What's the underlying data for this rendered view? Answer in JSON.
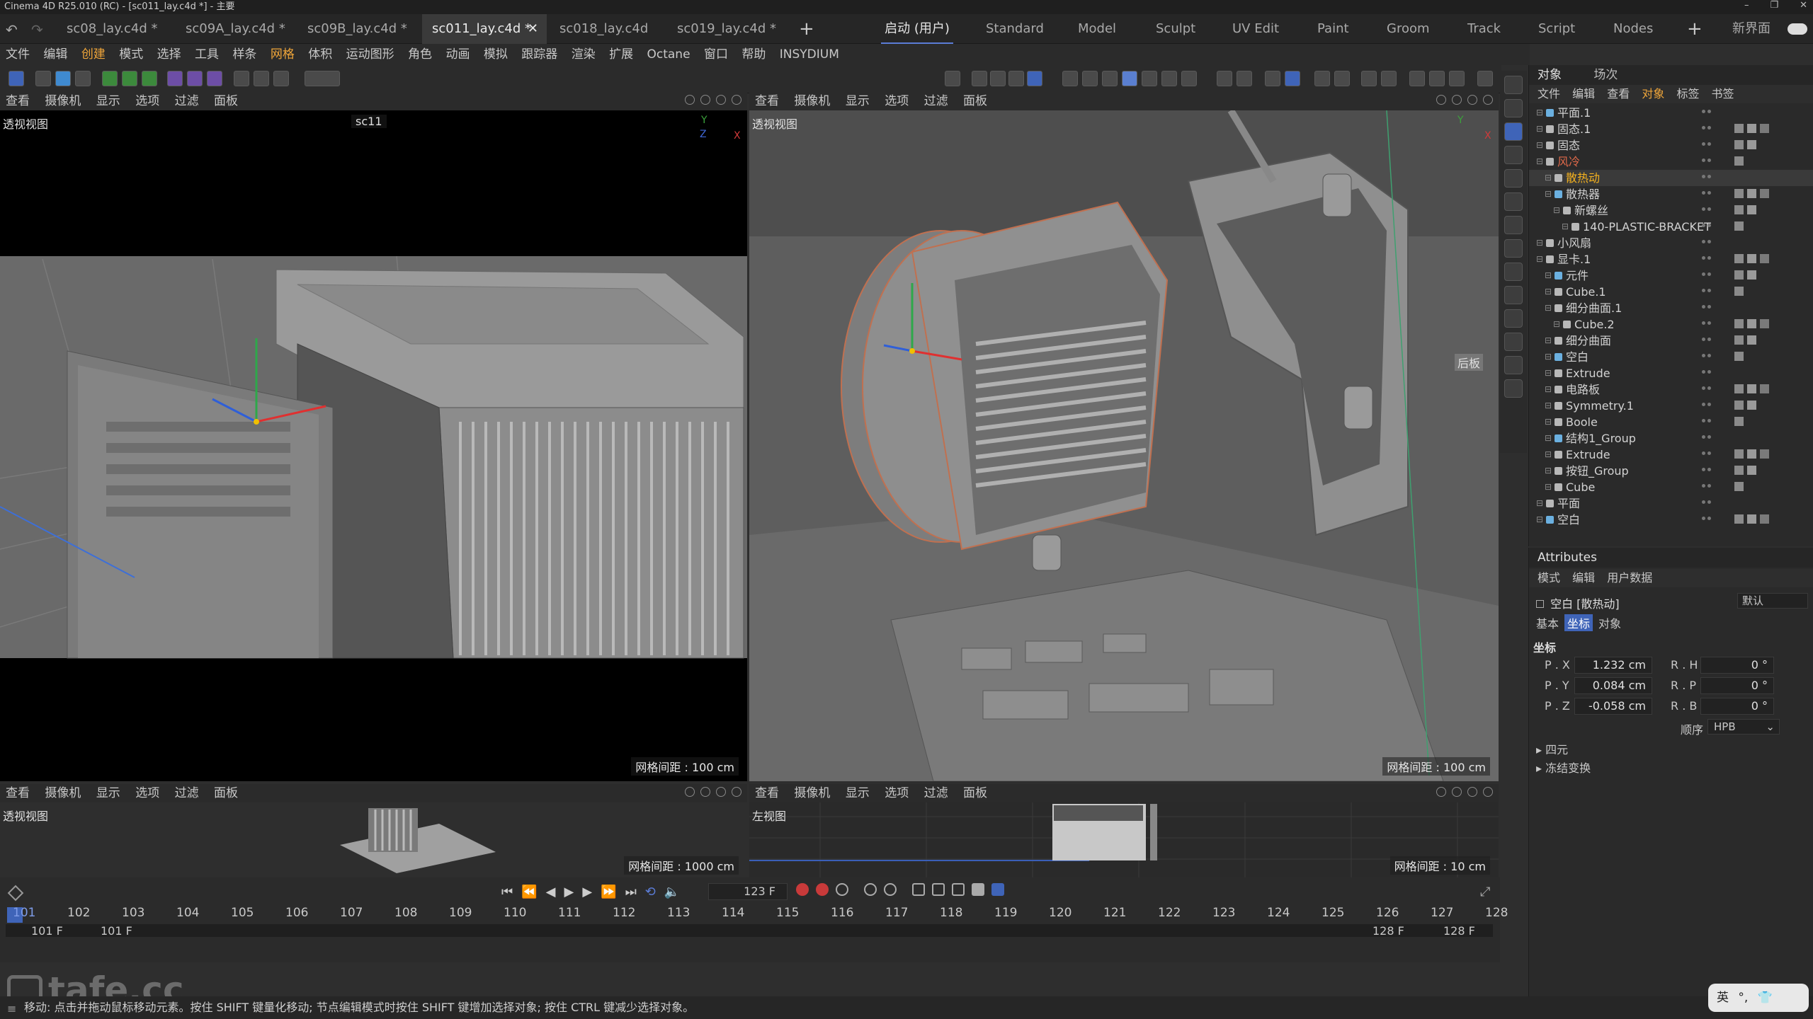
{
  "titlebar": {
    "text": "Cinema 4D R25.010 (RC) - [sc011_lay.c4d *] - 主要"
  },
  "file_tabs": [
    "sc08_lay.c4d *",
    "sc09A_lay.c4d *",
    "sc09B_lay.c4d *",
    "sc011_lay.c4d *",
    "sc018_lay.c4d",
    "sc019_lay.c4d *"
  ],
  "layout_tabs": [
    "启动 (用户)",
    "Standard",
    "Model",
    "Sculpt",
    "UV Edit",
    "Paint",
    "Groom",
    "Track",
    "Script",
    "Nodes",
    "新界面"
  ],
  "menu": [
    "文件",
    "编辑",
    "创建",
    "模式",
    "选择",
    "工具",
    "样条",
    "网格",
    "体积",
    "运动图形",
    "角色",
    "动画",
    "模拟",
    "跟踪器",
    "渲染",
    "扩展",
    "Octane",
    "窗口",
    "帮助",
    "INSYDIUM"
  ],
  "viewport_menu": [
    "查看",
    "摄像机",
    "显示",
    "选项",
    "过滤",
    "面板"
  ],
  "viewports": {
    "tl": {
      "name": "透视视图",
      "camera": "sc11",
      "grid": "网格间距 : 100 cm"
    },
    "tr": {
      "name": "透视视图",
      "tag": "后板",
      "grid": "网格间距 : 100 cm"
    },
    "bl": {
      "name": "透视视图",
      "grid": "网格间距 : 1000 cm"
    },
    "br": {
      "name": "左视图",
      "grid": "网格间距 : 10 cm"
    }
  },
  "object_manager": {
    "tabs": [
      "对象",
      "场次"
    ],
    "menu": [
      "文件",
      "编辑",
      "查看",
      "对象",
      "标签",
      "书签"
    ],
    "items": [
      {
        "name": "平面.1",
        "indent": 0,
        "color": "#d2d2d2"
      },
      {
        "name": "固态.1",
        "indent": 0,
        "color": "#d2d2d2"
      },
      {
        "name": "固态",
        "indent": 0,
        "color": "#d2d2d2"
      },
      {
        "name": "风冷",
        "indent": 0,
        "color": "#e0694a"
      },
      {
        "name": "散热动",
        "indent": 1,
        "color": "#f5b21f"
      },
      {
        "name": "散热器",
        "indent": 1,
        "color": "#d2d2d2"
      },
      {
        "name": "新螺丝",
        "indent": 2,
        "color": "#d2d2d2"
      },
      {
        "name": "140-PLASTIC-BRACKET",
        "indent": 3,
        "color": "#d2d2d2"
      },
      {
        "name": "小风扇",
        "indent": 0,
        "color": "#d2d2d2"
      },
      {
        "name": "显卡.1",
        "indent": 0,
        "color": "#d2d2d2"
      },
      {
        "name": "元件",
        "indent": 1,
        "color": "#d2d2d2"
      },
      {
        "name": "Cube.1",
        "indent": 1,
        "color": "#d2d2d2"
      },
      {
        "name": "细分曲面.1",
        "indent": 1,
        "color": "#d2d2d2"
      },
      {
        "name": "Cube.2",
        "indent": 2,
        "color": "#d2d2d2"
      },
      {
        "name": "细分曲面",
        "indent": 1,
        "color": "#d2d2d2"
      },
      {
        "name": "空白",
        "indent": 1,
        "color": "#d2d2d2"
      },
      {
        "name": "Extrude",
        "indent": 1,
        "color": "#d2d2d2"
      },
      {
        "name": "电路板",
        "indent": 1,
        "color": "#d2d2d2"
      },
      {
        "name": "Symmetry.1",
        "indent": 1,
        "color": "#d2d2d2"
      },
      {
        "name": "Boole",
        "indent": 1,
        "color": "#d2d2d2"
      },
      {
        "name": "结构1_Group",
        "indent": 1,
        "color": "#d2d2d2"
      },
      {
        "name": "Extrude",
        "indent": 1,
        "color": "#d2d2d2"
      },
      {
        "name": "按钮_Group",
        "indent": 1,
        "color": "#d2d2d2"
      },
      {
        "name": "Cube",
        "indent": 1,
        "color": "#d2d2d2"
      },
      {
        "name": "平面",
        "indent": 0,
        "color": "#d2d2d2"
      },
      {
        "name": "空白",
        "indent": 0,
        "color": "#d2d2d2"
      }
    ]
  },
  "attributes": {
    "title": "Attributes",
    "menu": [
      "模式",
      "编辑",
      "用户数据"
    ],
    "object": "空白 [散热动]",
    "preset": "默认",
    "tabs": [
      "基本",
      "坐标",
      "对象"
    ],
    "section": "坐标",
    "px_label": "P . X",
    "px": "1.232 cm",
    "py_label": "P . Y",
    "py": "0.084 cm",
    "pz_label": "P . Z",
    "pz": "-0.058 cm",
    "rh_label": "R . H",
    "rh": "0 °",
    "rp_label": "R . P",
    "rp": "0 °",
    "rb_label": "R . B",
    "rb": "0 °",
    "order_label": "顺序",
    "order": "HPB",
    "quat": "四元",
    "freeze": "冻结变换"
  },
  "timeline": {
    "current_frame": "123 F",
    "ticks": [
      "101",
      "102",
      "103",
      "104",
      "105",
      "106",
      "107",
      "108",
      "109",
      "110",
      "111",
      "112",
      "113",
      "114",
      "115",
      "116",
      "117",
      "118",
      "119",
      "120",
      "121",
      "122",
      "123",
      "124",
      "125",
      "126",
      "127",
      "128"
    ],
    "start_a": "101 F",
    "start_b": "101 F",
    "end_a": "128 F",
    "end_b": "128 F"
  },
  "status": "移动: 点击并拖动鼠标移动元素。按住 SHIFT 键量化移动; 节点编辑模式时按住 SHIFT 键增加选择对象; 按住 CTRL 键减少选择对象。",
  "watermark": "tafe.cc",
  "ime": "英"
}
